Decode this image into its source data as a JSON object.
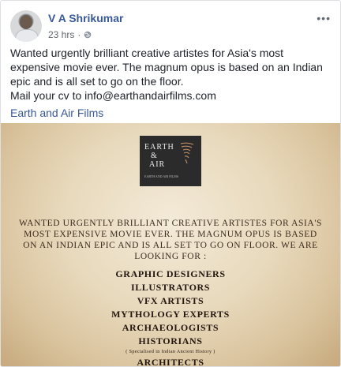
{
  "post": {
    "author": "V A Shrikumar",
    "time": "23 hrs",
    "separator": "·",
    "privacy_icon": "globe-icon",
    "more_icon": "more-options-icon",
    "more_glyph": "•••",
    "text_paragraph": "Wanted urgently brilliant creative artistes for Asia's most expensive movie ever. The magnum opus is based on an Indian epic and is all set to go on the floor.",
    "text_contact": "Mail your cv to info@earthandairfilms.com",
    "page_link": "Earth and Air Films"
  },
  "poster": {
    "logo_line1": "EARTH",
    "logo_line2": "&",
    "logo_line3": "AIR",
    "logo_sub": "EARTH AND AIR FILMS",
    "body": "Wanted urgently brilliant creative artistes for Asia's most expensive movie ever. The magnum opus is based on an Indian epic and is all set to go on floor. We are looking for :",
    "roles": [
      "Graphic designers",
      "Illustrators",
      "VFX artists",
      "Mythology experts",
      "Archaeologists",
      "Historians"
    ],
    "historians_note": "( Specialised in Indian Ancient History )",
    "last_role": "Architects"
  }
}
